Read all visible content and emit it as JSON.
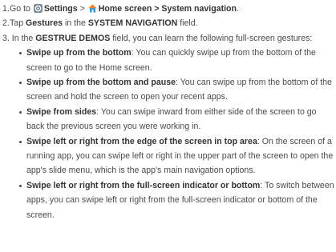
{
  "steps": [
    {
      "num": "1.",
      "go_to": "Go to",
      "settings": "Settings",
      "sep1": ">",
      "home_screen": "Home screen",
      "sep2": "> System navigation",
      "end": "."
    },
    {
      "num": "2.",
      "tap": "Tap",
      "gestures": "Gestures",
      "in_the": "in the",
      "field_name": "SYSTEM NAVIGATION",
      "field_word": "field."
    },
    {
      "num": "3.",
      "in_the": "In the",
      "field_name": "GESTRUE DEMOS",
      "rest": "field, you can learn the following full-screen gestures:"
    }
  ],
  "gestures": [
    {
      "title": "Swipe up from the bottom",
      "desc": ": You can quickly swipe up from the bottom of the screen to go to the Home screen."
    },
    {
      "title": "Swipe up from the bottom and pause",
      "desc": ": You can swipe up from the bottom of the screen and hold the screen to open your recent apps."
    },
    {
      "title": "Swipe from sides",
      "desc": ": You can swipe inward from either side of the screen to go back the previous screen you were working in."
    },
    {
      "title": "Swipe left or right from the edge of the screen in top area",
      "desc": ": On the screen of a running app, you can swipe left or right in the upper part of the screen to open the app's slide menu, which is the app's main navigation options."
    },
    {
      "title": "Swipe left or right from the full-screen indicator or bottom",
      "desc": ": To switch between apps, you can swipe left or right from the full-screen indicator or bottom of the screen."
    }
  ],
  "icons": {
    "settings": "settings-app-icon",
    "home": "home-icon"
  },
  "colors": {
    "text": "#4a4a4a",
    "settings_icon": "#7a8a99",
    "home_icon_roof": "#f5812b",
    "home_icon_body": "#2f9ad9"
  }
}
